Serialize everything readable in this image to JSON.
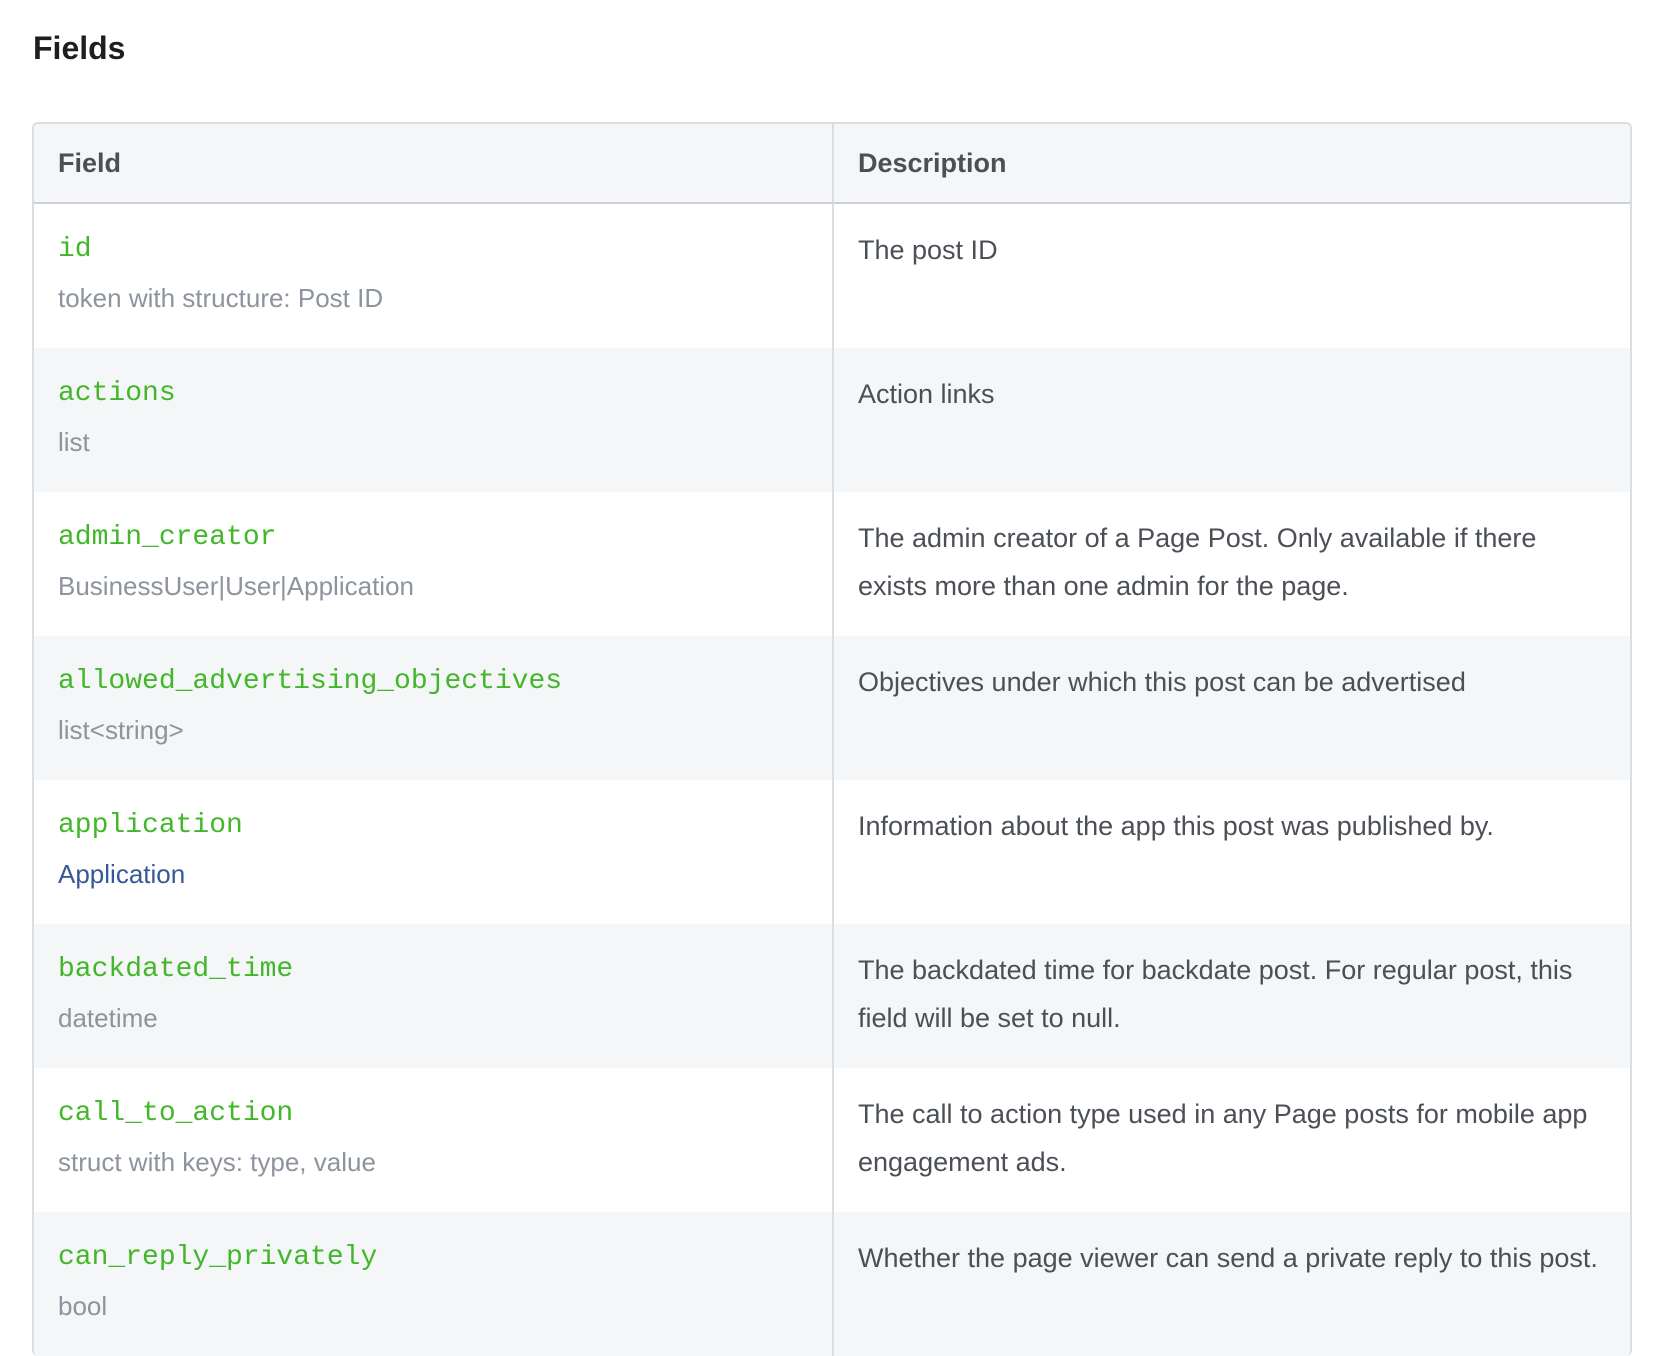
{
  "section": {
    "title": "Fields"
  },
  "table": {
    "headers": {
      "field": "Field",
      "description": "Description"
    },
    "rows": [
      {
        "name": "id",
        "type": "token with structure: Post ID",
        "type_is_link": false,
        "description": "The post ID"
      },
      {
        "name": "actions",
        "type": "list",
        "type_is_link": false,
        "description": "Action links"
      },
      {
        "name": "admin_creator",
        "type": "BusinessUser|User|Application",
        "type_is_link": false,
        "description": "The admin creator of a Page Post. Only available if there exists more than one admin for the page."
      },
      {
        "name": "allowed_advertising_objectives",
        "type": "list<string>",
        "type_is_link": false,
        "description": "Objectives under which this post can be advertised"
      },
      {
        "name": "application",
        "type": "Application",
        "type_is_link": true,
        "description": "Information about the app this post was published by."
      },
      {
        "name": "backdated_time",
        "type": "datetime",
        "type_is_link": false,
        "description": "The backdated time for backdate post. For regular post, this field will be set to null."
      },
      {
        "name": "call_to_action",
        "type": "struct with keys: type, value",
        "type_is_link": false,
        "description": "The call to action type used in any Page posts for mobile app engagement ads."
      },
      {
        "name": "can_reply_privately",
        "type": "bool",
        "type_is_link": false,
        "description": "Whether the page viewer can send a private reply to this post."
      }
    ]
  },
  "colors": {
    "field_name": "#42b72a",
    "type_text": "#8d949e",
    "type_link": "#365899",
    "header_bg": "#f5f6f7",
    "stripe_bg": "#f5f6f7",
    "border": "#dadde1"
  }
}
